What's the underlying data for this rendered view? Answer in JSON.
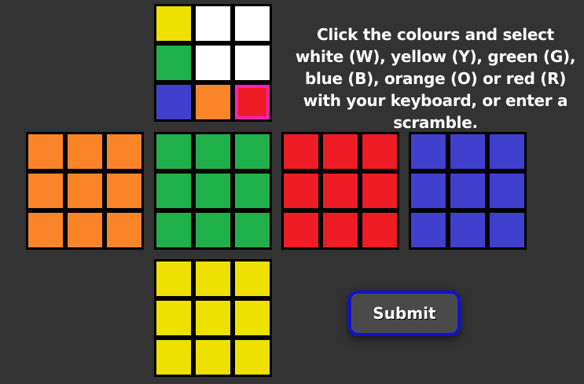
{
  "colors": {
    "W": "#ffffff",
    "Y": "#eee000",
    "G": "#20b04a",
    "B": "#4040cf",
    "O": "#fa8428",
    "R": "#ee1c24"
  },
  "faces": {
    "up": [
      "Y",
      "W",
      "W",
      "G",
      "W",
      "W",
      "B",
      "O",
      "R"
    ],
    "left": [
      "O",
      "O",
      "O",
      "O",
      "O",
      "O",
      "O",
      "O",
      "O"
    ],
    "front": [
      "G",
      "G",
      "G",
      "G",
      "G",
      "G",
      "G",
      "G",
      "G"
    ],
    "right": [
      "R",
      "R",
      "R",
      "R",
      "R",
      "R",
      "R",
      "R",
      "R"
    ],
    "back": [
      "B",
      "B",
      "B",
      "B",
      "B",
      "B",
      "B",
      "B",
      "B"
    ],
    "down": [
      "Y",
      "Y",
      "Y",
      "Y",
      "Y",
      "Y",
      "Y",
      "Y",
      "Y"
    ]
  },
  "selected": {
    "face": "up",
    "index": 8
  },
  "instructions": "Click the colours and select white (W), yellow (Y), green (G), blue (B), orange (O) or red (R) with your keyboard, or enter a scramble.",
  "submit_label": "Submit"
}
